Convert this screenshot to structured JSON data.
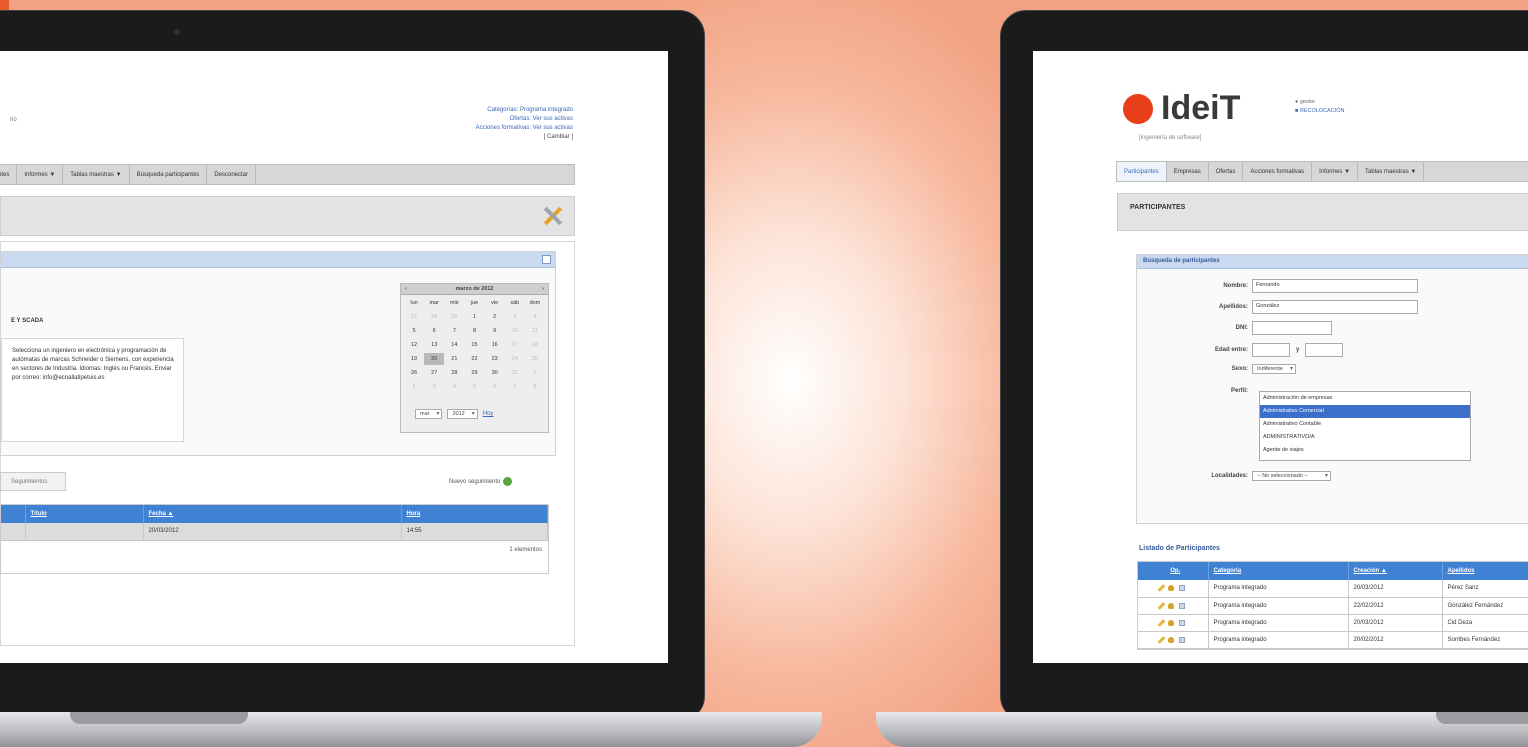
{
  "left_app": {
    "brand_fragment": "rio",
    "header_links": [
      "Categorías: Programa integrado",
      "Ofertas: Ver sus activas",
      "Acciones formativas: Ver sus activas",
      "[ Cambiar ]"
    ],
    "nav": [
      "ntes",
      "Informes ▼",
      "Tablas maestras ▼",
      "Búsqueda participantes",
      "Desconectar"
    ],
    "section_label": "E Y SCADA",
    "description": "Selecciona un ingeniero en electrónica y programación de autómatas de marcas Schneider o Siemens, con experiencia en sectores de Industria. Idiomas: Inglés ou Francés. Enviar por correo: info@ecnallatipetuis.es",
    "calendar": {
      "prev": "‹",
      "title": "marzo de 2012",
      "next": "›",
      "weekdays": [
        "lun",
        "mar",
        "mié",
        "jue",
        "vie",
        "sáb",
        "dom"
      ],
      "days": [
        "27",
        "28",
        "29",
        "1",
        "2",
        "3",
        "4",
        "5",
        "6",
        "7",
        "8",
        "9",
        "10",
        "11",
        "12",
        "13",
        "14",
        "15",
        "16",
        "17",
        "18",
        "19",
        "20",
        "21",
        "22",
        "23",
        "24",
        "25",
        "26",
        "27",
        "28",
        "29",
        "30",
        "31",
        "1",
        "2",
        "3",
        "4",
        "5",
        "6",
        "7",
        "8"
      ],
      "month_select": "mar",
      "year_select": "2012",
      "go": "Hoy"
    },
    "tab": "Seguimientos",
    "new_link": "Nuevo seguimiento",
    "table": {
      "headers": [
        "",
        "Título",
        "Fecha ▲",
        "Hora"
      ],
      "rows": [
        [
          "",
          "",
          "20/03/2012",
          "14:55"
        ]
      ],
      "count": "1 elementos"
    }
  },
  "right_app": {
    "logo": "IdeiT",
    "logo_sub": "[ingeniería de software]",
    "user_lines": [
      "gestor",
      "RECOLOCACIÓN"
    ],
    "nav": [
      "Participantes",
      "Empresas",
      "Ofertas",
      "Acciones formativas",
      "Informes ▼",
      "Tablas maestras ▼"
    ],
    "title": "PARTICIPANTES",
    "search": {
      "heading": "Búsqueda de participantes",
      "nombre_label": "Nombre:",
      "nombre_value": "Fernando",
      "apellidos_label": "Apellidos:",
      "apellidos_value": "González",
      "dni_label": "DNI:",
      "dni_value": "",
      "edad_label": "Edad entre:",
      "edad_and": "y",
      "sexo_label": "Sexo:",
      "sexo_value": "Indiferente",
      "perfil_label": "Perfil:",
      "perfil_options": [
        "Administración de empresas",
        "Administrativo Comercial",
        "Administrativo Contable",
        "ADMINISTRATIVO/A",
        "Agente de viajes"
      ],
      "localidades_label": "Localidades:",
      "localidades_value": "-- No seleccionado --"
    },
    "listado": "Listado de Participantes",
    "table": {
      "headers": [
        "Op.",
        "Categoría",
        "Creación ▲",
        "Apellidos"
      ],
      "rows": [
        [
          "Programa integrado",
          "20/03/2012",
          "Pérez Sanz"
        ],
        [
          "Programa integrado",
          "22/02/2012",
          "González Fernández"
        ],
        [
          "Programa integrado",
          "20/03/2012",
          "Cid Deza"
        ],
        [
          "Programa integrado",
          "20/02/2012",
          "Sorribes Fernández"
        ]
      ]
    }
  }
}
